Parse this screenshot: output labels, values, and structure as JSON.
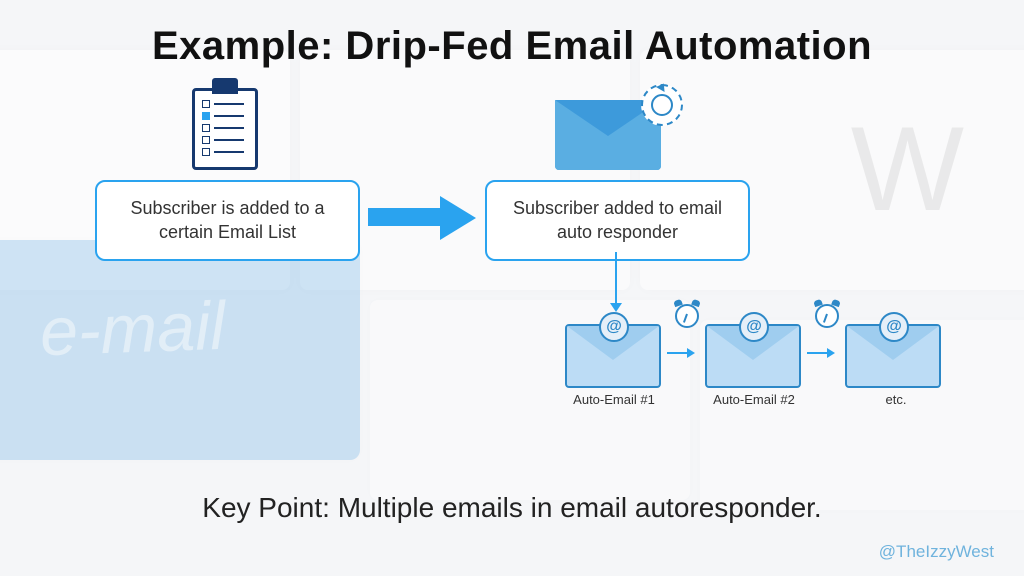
{
  "title": "Example: Drip-Fed Email Automation",
  "boxA": "Subscriber is added to a certain Email List",
  "boxB": "Subscriber added to email auto responder",
  "autoEmails": {
    "label1": "Auto-Email #1",
    "label2": "Auto-Email #2",
    "label3": "etc."
  },
  "keyPoint": "Key Point: Multiple emails in email autoresponder.",
  "handle": "@TheIzzyWest",
  "bgEmailText": "e-mail",
  "bgKeyW": "W"
}
